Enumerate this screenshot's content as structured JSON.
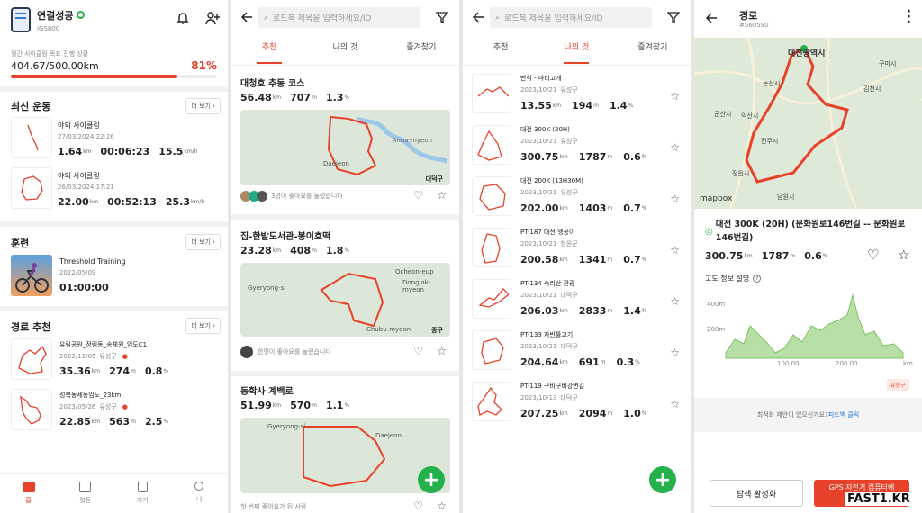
{
  "screen1": {
    "user_name": "연결성공",
    "user_id": "iGS800",
    "goal_label": "월간 사이클링 목표 진행 상황",
    "goal_value": "404.67/500.00km",
    "goal_percent": "81%",
    "goal_fraction": 0.81,
    "recent_title": "최신 운동",
    "more_label": "더 보기",
    "activities": [
      {
        "title": "야외 사이클링",
        "date": "27/03/2024,22:26",
        "dist": "1.64",
        "dist_unit": "km",
        "time": "00:06:23",
        "speed": "15.5",
        "speed_unit": "km/h"
      },
      {
        "title": "야외 사이클링",
        "date": "26/03/2024,17:21",
        "dist": "22.00",
        "dist_unit": "km",
        "time": "00:52:13",
        "speed": "25.3",
        "speed_unit": "km/h"
      }
    ],
    "training_title": "훈련",
    "training": {
      "name": "Threshold Training",
      "date": "2022/05/09",
      "time": "01:00:00"
    },
    "routes_title": "경로 추천",
    "routes": [
      {
        "title": "유림공원_정림동_송체원_임도C1",
        "date": "2022/11/05",
        "author": "유성구",
        "dist": "35.36",
        "dist_unit": "km",
        "elev": "274",
        "elev_unit": "m",
        "grade": "0.8",
        "grade_unit": "%"
      },
      {
        "title": "성북동세동임도_23km",
        "date": "2023/05/26",
        "author": "유성구",
        "dist": "22.85",
        "dist_unit": "km",
        "elev": "563",
        "elev_unit": "m",
        "grade": "2.5",
        "grade_unit": "%"
      }
    ],
    "nav": [
      {
        "label": "홈",
        "icon": "home-icon"
      },
      {
        "label": "활동",
        "icon": "map-icon"
      },
      {
        "label": "기기",
        "icon": "device-icon"
      },
      {
        "label": "나",
        "icon": "person-icon"
      }
    ]
  },
  "screen2": {
    "search_placeholder": "로드북 제목을 입력하세요/ID",
    "tabs": [
      "추천",
      "나의 것",
      "즐겨찾기"
    ],
    "cards": [
      {
        "title": "대청호 추동 코스",
        "dist": "56.48",
        "dist_unit": "km",
        "elev": "707",
        "elev_unit": "m",
        "grade": "1.3",
        "grade_unit": "%",
        "footer": "3명이 좋아요를 눌렀습니다",
        "map_labels": [
          "Daejeon",
          "대덕구",
          "Anna-myeon"
        ]
      },
      {
        "title": "집-한밭도서관-봉이호떡",
        "dist": "23.28",
        "dist_unit": "km",
        "elev": "408",
        "elev_unit": "m",
        "grade": "1.8",
        "grade_unit": "%",
        "footer": "한명이 좋아요를 눌렀습니다",
        "map_labels": [
          "Gyeryong-si",
          "Ocheon-eup",
          "Dongjak-myeon",
          "Chubu-myeon",
          "중구"
        ]
      },
      {
        "title": "동학사 계백로",
        "dist": "51.99",
        "dist_unit": "km",
        "elev": "570",
        "elev_unit": "m",
        "grade": "1.1",
        "grade_unit": "%",
        "footer": "첫 번째 좋아요가 된 사람",
        "map_labels": [
          "Daejeon",
          "Gyeryong-si"
        ]
      }
    ]
  },
  "screen3": {
    "search_placeholder": "로드북 제목을 입력하세요/ID",
    "tabs": [
      "추천",
      "나의 것",
      "즐겨찾기"
    ],
    "items": [
      {
        "title": "반석 - 마티고개",
        "date": "2023/10/21",
        "author": "유성구",
        "dist": "13.55",
        "elev": "194",
        "grade": "1.4"
      },
      {
        "title": "대전 300K (20H)",
        "date": "2023/10/21",
        "author": "유성구",
        "dist": "300.75",
        "elev": "1787",
        "grade": "0.6"
      },
      {
        "title": "대전 200K (13H30M)",
        "date": "2023/10/21",
        "author": "유성구",
        "dist": "202.00",
        "elev": "1403",
        "grade": "0.7"
      },
      {
        "title": "PT-187 대전 맹꽁이",
        "date": "2023/10/21",
        "author": "청원군",
        "dist": "200.58",
        "elev": "1341",
        "grade": "0.7"
      },
      {
        "title": "PT-134 속리산 관광",
        "date": "2023/10/21",
        "author": "대덕구",
        "dist": "206.03",
        "elev": "2833",
        "grade": "1.4"
      },
      {
        "title": "PT-133 자반률고기",
        "date": "2023/10/21",
        "author": "대덕구",
        "dist": "204.64",
        "elev": "691",
        "grade": "0.3"
      },
      {
        "title": "PT-119 구비구비강변길",
        "date": "2023/10/13",
        "author": "대덕구",
        "dist": "207.25",
        "elev": "2094",
        "grade": "1.0"
      }
    ],
    "units": {
      "dist": "km",
      "elev": "m",
      "grade": "%"
    }
  },
  "screen4": {
    "title": "경로",
    "route_id": "#560590",
    "route_name": "대전 300K (20H) (문화원로146번길 -- 문화원로146번길)",
    "dist": "300.75",
    "dist_unit": "km",
    "elev": "1787",
    "elev_unit": "m",
    "grade": "0.6",
    "grade_unit": "%",
    "elev_title": "고도 정보 설명",
    "y_ticks": [
      "400m",
      "200m"
    ],
    "x_ticks": [
      "100.00",
      "200.00",
      "km"
    ],
    "badge": "유성구",
    "feedback_text": "최적화 제안이 있으신가요?",
    "feedback_link": "피드백 클릭",
    "btn_explore": "탐색 활성화",
    "btn_gps": "GPS 자전거 컴퓨터에",
    "map_labels": [
      "대전광역시",
      "논산시",
      "익산시",
      "군산시",
      "전주시",
      "정읍시",
      "남원시",
      "김천시",
      "구미시",
      "mapbox"
    ],
    "watermark": "FAST1.KR"
  },
  "colors": {
    "accent": "#e8412a",
    "green": "#24b14b"
  }
}
